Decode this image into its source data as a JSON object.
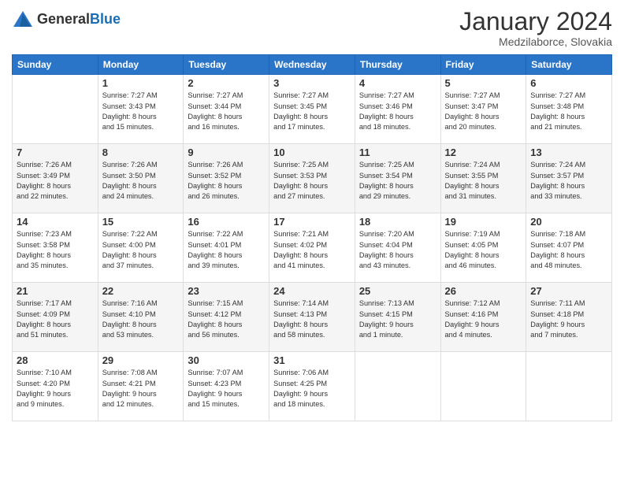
{
  "logo": {
    "general": "General",
    "blue": "Blue"
  },
  "header": {
    "month": "January 2024",
    "location": "Medzilaborce, Slovakia"
  },
  "weekdays": [
    "Sunday",
    "Monday",
    "Tuesday",
    "Wednesday",
    "Thursday",
    "Friday",
    "Saturday"
  ],
  "weeks": [
    [
      {
        "day": "",
        "info": ""
      },
      {
        "day": "1",
        "info": "Sunrise: 7:27 AM\nSunset: 3:43 PM\nDaylight: 8 hours\nand 15 minutes."
      },
      {
        "day": "2",
        "info": "Sunrise: 7:27 AM\nSunset: 3:44 PM\nDaylight: 8 hours\nand 16 minutes."
      },
      {
        "day": "3",
        "info": "Sunrise: 7:27 AM\nSunset: 3:45 PM\nDaylight: 8 hours\nand 17 minutes."
      },
      {
        "day": "4",
        "info": "Sunrise: 7:27 AM\nSunset: 3:46 PM\nDaylight: 8 hours\nand 18 minutes."
      },
      {
        "day": "5",
        "info": "Sunrise: 7:27 AM\nSunset: 3:47 PM\nDaylight: 8 hours\nand 20 minutes."
      },
      {
        "day": "6",
        "info": "Sunrise: 7:27 AM\nSunset: 3:48 PM\nDaylight: 8 hours\nand 21 minutes."
      }
    ],
    [
      {
        "day": "7",
        "info": "Sunrise: 7:26 AM\nSunset: 3:49 PM\nDaylight: 8 hours\nand 22 minutes."
      },
      {
        "day": "8",
        "info": "Sunrise: 7:26 AM\nSunset: 3:50 PM\nDaylight: 8 hours\nand 24 minutes."
      },
      {
        "day": "9",
        "info": "Sunrise: 7:26 AM\nSunset: 3:52 PM\nDaylight: 8 hours\nand 26 minutes."
      },
      {
        "day": "10",
        "info": "Sunrise: 7:25 AM\nSunset: 3:53 PM\nDaylight: 8 hours\nand 27 minutes."
      },
      {
        "day": "11",
        "info": "Sunrise: 7:25 AM\nSunset: 3:54 PM\nDaylight: 8 hours\nand 29 minutes."
      },
      {
        "day": "12",
        "info": "Sunrise: 7:24 AM\nSunset: 3:55 PM\nDaylight: 8 hours\nand 31 minutes."
      },
      {
        "day": "13",
        "info": "Sunrise: 7:24 AM\nSunset: 3:57 PM\nDaylight: 8 hours\nand 33 minutes."
      }
    ],
    [
      {
        "day": "14",
        "info": "Sunrise: 7:23 AM\nSunset: 3:58 PM\nDaylight: 8 hours\nand 35 minutes."
      },
      {
        "day": "15",
        "info": "Sunrise: 7:22 AM\nSunset: 4:00 PM\nDaylight: 8 hours\nand 37 minutes."
      },
      {
        "day": "16",
        "info": "Sunrise: 7:22 AM\nSunset: 4:01 PM\nDaylight: 8 hours\nand 39 minutes."
      },
      {
        "day": "17",
        "info": "Sunrise: 7:21 AM\nSunset: 4:02 PM\nDaylight: 8 hours\nand 41 minutes."
      },
      {
        "day": "18",
        "info": "Sunrise: 7:20 AM\nSunset: 4:04 PM\nDaylight: 8 hours\nand 43 minutes."
      },
      {
        "day": "19",
        "info": "Sunrise: 7:19 AM\nSunset: 4:05 PM\nDaylight: 8 hours\nand 46 minutes."
      },
      {
        "day": "20",
        "info": "Sunrise: 7:18 AM\nSunset: 4:07 PM\nDaylight: 8 hours\nand 48 minutes."
      }
    ],
    [
      {
        "day": "21",
        "info": "Sunrise: 7:17 AM\nSunset: 4:09 PM\nDaylight: 8 hours\nand 51 minutes."
      },
      {
        "day": "22",
        "info": "Sunrise: 7:16 AM\nSunset: 4:10 PM\nDaylight: 8 hours\nand 53 minutes."
      },
      {
        "day": "23",
        "info": "Sunrise: 7:15 AM\nSunset: 4:12 PM\nDaylight: 8 hours\nand 56 minutes."
      },
      {
        "day": "24",
        "info": "Sunrise: 7:14 AM\nSunset: 4:13 PM\nDaylight: 8 hours\nand 58 minutes."
      },
      {
        "day": "25",
        "info": "Sunrise: 7:13 AM\nSunset: 4:15 PM\nDaylight: 9 hours\nand 1 minute."
      },
      {
        "day": "26",
        "info": "Sunrise: 7:12 AM\nSunset: 4:16 PM\nDaylight: 9 hours\nand 4 minutes."
      },
      {
        "day": "27",
        "info": "Sunrise: 7:11 AM\nSunset: 4:18 PM\nDaylight: 9 hours\nand 7 minutes."
      }
    ],
    [
      {
        "day": "28",
        "info": "Sunrise: 7:10 AM\nSunset: 4:20 PM\nDaylight: 9 hours\nand 9 minutes."
      },
      {
        "day": "29",
        "info": "Sunrise: 7:08 AM\nSunset: 4:21 PM\nDaylight: 9 hours\nand 12 minutes."
      },
      {
        "day": "30",
        "info": "Sunrise: 7:07 AM\nSunset: 4:23 PM\nDaylight: 9 hours\nand 15 minutes."
      },
      {
        "day": "31",
        "info": "Sunrise: 7:06 AM\nSunset: 4:25 PM\nDaylight: 9 hours\nand 18 minutes."
      },
      {
        "day": "",
        "info": ""
      },
      {
        "day": "",
        "info": ""
      },
      {
        "day": "",
        "info": ""
      }
    ]
  ]
}
